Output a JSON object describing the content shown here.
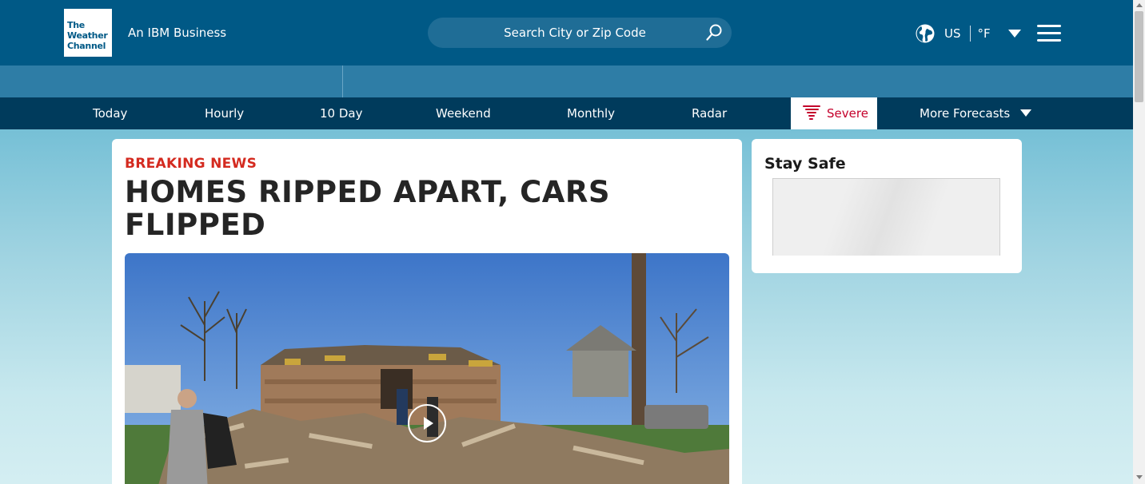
{
  "header": {
    "logo_lines": [
      "The",
      "Weather",
      "Channel"
    ],
    "tagline_prefix": "An ",
    "tagline_brand": "IBM Business",
    "search_placeholder": "Search City or Zip Code",
    "region": "US",
    "unit": "°F"
  },
  "nav": {
    "items": [
      "Today",
      "Hourly",
      "10 Day",
      "Weekend",
      "Monthly",
      "Radar"
    ],
    "severe_label": "Severe",
    "more_label": "More Forecasts"
  },
  "article": {
    "kicker": "BREAKING NEWS",
    "headline": "HOMES RIPPED APART, CARS FLIPPED"
  },
  "sidebar": {
    "title": "Stay Safe"
  },
  "colors": {
    "header_bg": "#005986",
    "subbar_bg": "#2e7da6",
    "nav_bg": "#003b5c",
    "severe_red": "#c4002b",
    "breaking_red": "#d42a1f"
  },
  "icons": [
    "search-icon",
    "globe-icon",
    "chevron-down-icon",
    "menu-icon",
    "tornado-icon",
    "play-icon"
  ]
}
